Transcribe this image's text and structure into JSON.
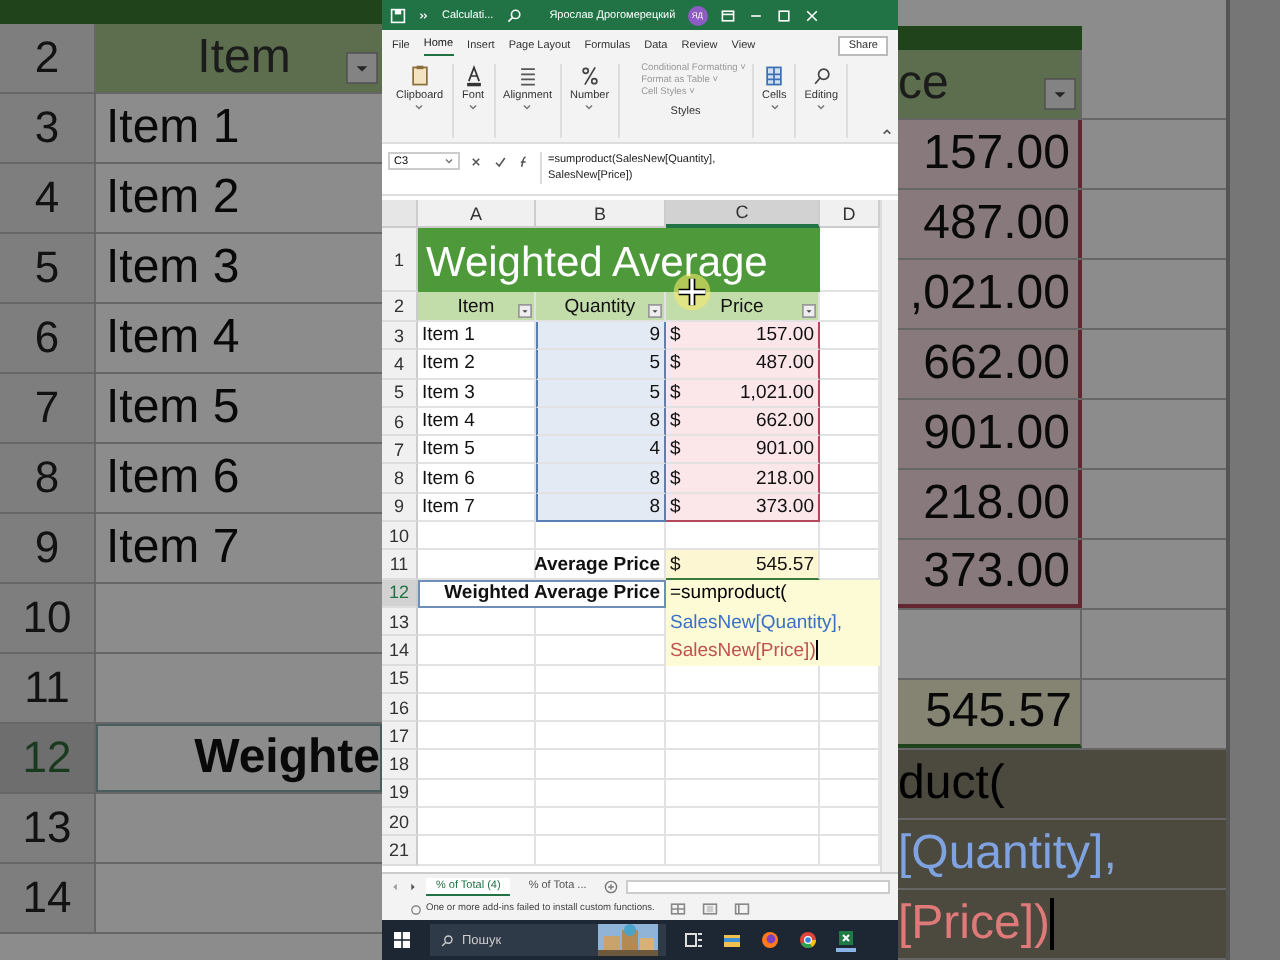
{
  "left_zoom": {
    "rows": [
      {
        "kind": "header",
        "num": "2",
        "text": "Item"
      },
      {
        "kind": "data",
        "num": "3",
        "text": "Item 1"
      },
      {
        "kind": "data",
        "num": "4",
        "text": "Item 2"
      },
      {
        "kind": "data",
        "num": "5",
        "text": "Item 3"
      },
      {
        "kind": "data",
        "num": "6",
        "text": "Item 4"
      },
      {
        "kind": "data",
        "num": "7",
        "text": "Item 5"
      },
      {
        "kind": "data",
        "num": "8",
        "text": "Item 6"
      },
      {
        "kind": "data",
        "num": "9",
        "text": "Item 7"
      },
      {
        "kind": "empty",
        "num": "10"
      },
      {
        "kind": "empty",
        "num": "11"
      },
      {
        "kind": "label",
        "num": "12",
        "text": "Weighte"
      },
      {
        "kind": "empty",
        "num": "13"
      },
      {
        "kind": "empty",
        "num": "14"
      }
    ]
  },
  "excel": {
    "title_bar": {
      "file_name": "Calculati...",
      "user": "Ярослав Дрогомерецкий",
      "avatar": "ЯД"
    },
    "menu_tabs": [
      {
        "label": "File",
        "selected": false
      },
      {
        "label": "Home",
        "selected": true
      },
      {
        "label": "Insert",
        "selected": false
      },
      {
        "label": "Page Layout",
        "selected": false
      },
      {
        "label": "Formulas",
        "selected": false
      },
      {
        "label": "Data",
        "selected": false
      },
      {
        "label": "Review",
        "selected": false
      },
      {
        "label": "View",
        "selected": false
      }
    ],
    "share": "Share",
    "ribbon": {
      "groups": [
        {
          "kind": "clipboard",
          "label": "Clipboard"
        },
        {
          "kind": "font",
          "label": "Font"
        },
        {
          "kind": "alignment",
          "label": "Alignment"
        },
        {
          "kind": "number",
          "label": "Number"
        },
        {
          "kind": "styles",
          "label": "Styles",
          "items": [
            "Conditional Formatting ˅",
            "Format as Table ˅",
            "Cell Styles ˅"
          ]
        },
        {
          "kind": "cells",
          "label": "Cells"
        },
        {
          "kind": "editing",
          "label": "Editing"
        }
      ]
    },
    "formula_bar": {
      "name_box": "C3",
      "lines": [
        "=sumproduct(SalesNew[Quantity],",
        "SalesNew[Price])"
      ]
    },
    "columns": [
      {
        "label": "A",
        "selected": false
      },
      {
        "label": "B",
        "selected": false
      },
      {
        "label": "C",
        "selected": true
      },
      {
        "label": "D",
        "selected": false
      }
    ],
    "rows": [
      {
        "kind": "title",
        "num": "1",
        "selected": false,
        "text": "Weighted Average"
      },
      {
        "kind": "header",
        "num": "2",
        "selected": false,
        "headers": [
          "Item",
          "Quantity",
          "Price"
        ]
      },
      {
        "kind": "data",
        "num": "3",
        "selected": false,
        "item": "Item 1",
        "quantity": "9",
        "currency": "$",
        "price": "157.00"
      },
      {
        "kind": "data",
        "num": "4",
        "selected": false,
        "item": "Item 2",
        "quantity": "5",
        "currency": "$",
        "price": "487.00"
      },
      {
        "kind": "data",
        "num": "5",
        "selected": false,
        "item": "Item 3",
        "quantity": "5",
        "currency": "$",
        "price": "1,021.00"
      },
      {
        "kind": "data",
        "num": "6",
        "selected": false,
        "item": "Item 4",
        "quantity": "8",
        "currency": "$",
        "price": "662.00"
      },
      {
        "kind": "data",
        "num": "7",
        "selected": false,
        "item": "Item 5",
        "quantity": "4",
        "currency": "$",
        "price": "901.00"
      },
      {
        "kind": "data",
        "num": "8",
        "selected": false,
        "item": "Item 6",
        "quantity": "8",
        "currency": "$",
        "price": "218.00"
      },
      {
        "kind": "data",
        "num": "9",
        "selected": false,
        "item": "Item 7",
        "quantity": "8",
        "currency": "$",
        "price": "373.00"
      },
      {
        "kind": "empty",
        "num": "10",
        "selected": false
      },
      {
        "kind": "total",
        "num": "11",
        "selected": false,
        "label": "Average Price",
        "currency": "$",
        "value": "545.57"
      },
      {
        "kind": "formula",
        "num": "12",
        "selected": true,
        "label": "Weighted Average Price",
        "text": "=sumproduct(",
        "color": "#000000"
      },
      {
        "kind": "formula_line",
        "num": "13",
        "selected": false,
        "text": "SalesNew[Quantity],",
        "color": "#3a6fc4"
      },
      {
        "kind": "formula_line",
        "num": "14",
        "selected": false,
        "text": "SalesNew[Price])",
        "color": "#c0504d",
        "caret": true
      },
      {
        "kind": "empty",
        "num": "15",
        "selected": false
      },
      {
        "kind": "empty",
        "num": "16",
        "selected": false
      },
      {
        "kind": "empty",
        "num": "17",
        "selected": false
      },
      {
        "kind": "empty",
        "num": "18",
        "selected": false
      },
      {
        "kind": "empty",
        "num": "19",
        "selected": false
      },
      {
        "kind": "empty",
        "num": "20",
        "selected": false
      },
      {
        "kind": "empty",
        "num": "21",
        "selected": false
      }
    ],
    "sheet_tabs": [
      {
        "label": "% of Total (4)",
        "selected": true
      },
      {
        "label": "% of Tota ...",
        "selected": false
      }
    ],
    "status_message": "One or more add-ins failed to install custom functions.",
    "taskbar": {
      "search_placeholder": "Пошук"
    }
  },
  "right_zoom": {
    "rows": [
      {
        "kind": "header",
        "text": "ce"
      },
      {
        "kind": "data",
        "text": "157.00"
      },
      {
        "kind": "data",
        "text": "487.00"
      },
      {
        "kind": "data",
        "text": ",021.00"
      },
      {
        "kind": "data",
        "text": "662.00"
      },
      {
        "kind": "data",
        "text": "901.00"
      },
      {
        "kind": "data",
        "text": "218.00"
      },
      {
        "kind": "data",
        "text": "373.00"
      },
      {
        "kind": "empty"
      },
      {
        "kind": "total",
        "text": "545.57"
      },
      {
        "kind": "formula",
        "text": "duct(",
        "color": "#000000"
      },
      {
        "kind": "formula",
        "text": "[Quantity],",
        "color": "#7fa2e0"
      },
      {
        "kind": "formula",
        "text": "[Price])",
        "color": "#e07a7a",
        "caret": true
      }
    ]
  }
}
